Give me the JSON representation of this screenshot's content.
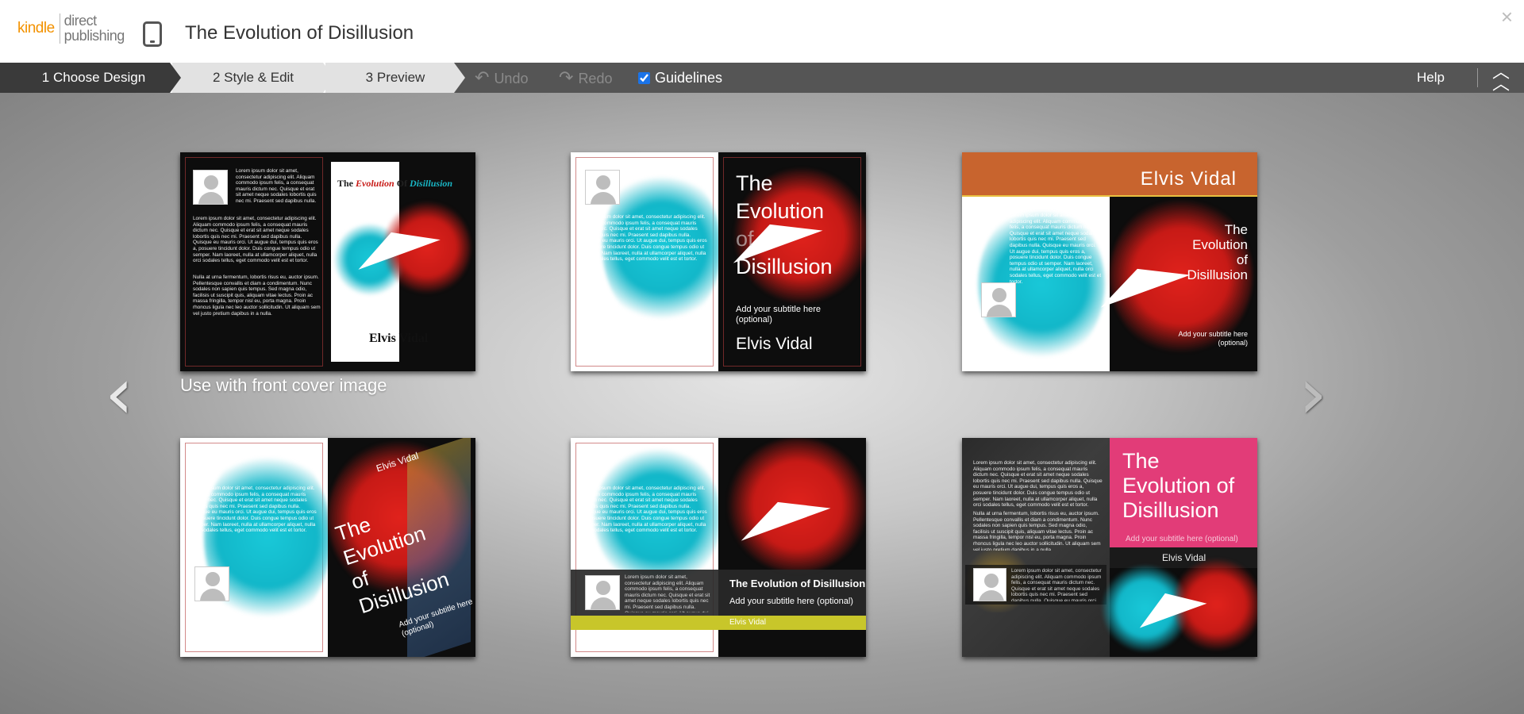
{
  "header": {
    "logo_kindle": "kindle",
    "logo_direct": "direct",
    "logo_publishing": "publishing",
    "book_title": "The Evolution of Disillusion",
    "close_label": "×"
  },
  "toolbar": {
    "steps": [
      {
        "label": "1 Choose Design"
      },
      {
        "label": "2 Style & Edit"
      },
      {
        "label": "3 Preview"
      }
    ],
    "undo_label": "Undo",
    "redo_label": "Redo",
    "guidelines_label": "Guidelines",
    "guidelines_checked": true,
    "help_label": "Help"
  },
  "gallery": {
    "caption": "Use with front cover image",
    "nav_left": "‹",
    "nav_right": "›",
    "lorem_short": "Lorem ipsum dolor sit amet, consectetur adipiscing elit. Aliquam commodo ipsum felis, a consequat mauris dictum nec. Quisque et erat sit amet neque sodales lobortis quis nec mi. Praesent sed dapibus nulla. Quisque eu mauris orci. Ut augue dui, tempus quis eros a, posuere tincidunt dolor. Duis congue tempus odio ut semper.",
    "lorem_long": "Lorem ipsum dolor sit amet, consectetur adipiscing elit. Aliquam commodo ipsum felis, a consequat mauris dictum nec. Quisque et erat sit amet neque sodales lobortis quis nec mi. Praesent sed dapibus nulla. Quisque eu mauris orci. Ut augue dui, tempus quis eros a, posuere tincidunt dolor. Duis congue tempus odio ut semper. Nam laoreet, nulla at ullamcorper aliquet, nulla orci sodales tellus, eget commodo velit est et tortor.",
    "lorem_para2": "Nulla at urna fermentum, lobortis risus eu, auctor ipsum. Pellentesque convallis et diam a condimentum. Nunc sodales non sapien quis tempus. Sed magna odio, facilisis ut suscipit quis, aliquam vitae lectus. Proin ac massa fringilla, tempor nisl eu, porta magna. Proin rhoncus ligula nec leo auctor sollicitudin. Ut aliquam sem vel justo pretium dapibus in a nulla.",
    "designs": [
      {
        "title_the": "The",
        "title_evolution": "Evolution",
        "title_of": "Of",
        "title_disillusion": "Disillusion",
        "author": "Elvis Vidal"
      },
      {
        "title_l1": "The",
        "title_l2": "Evolution",
        "title_l3": "of",
        "title_l4": "Disillusion",
        "subtitle": "Add your subtitle here (optional)",
        "author": "Elvis Vidal"
      },
      {
        "author": "Elvis Vidal",
        "title_l1": "The",
        "title_l2": "Evolution",
        "title_l3": "of",
        "title_l4": "Disillusion",
        "subtitle": "Add your subtitle here (optional)"
      },
      {
        "author": "Elvis Vidal",
        "title_l1": "The",
        "title_l2": "Evolution",
        "title_l3": "of",
        "title_l4": "Disillusion",
        "subtitle": "Add your subtitle here (optional)"
      },
      {
        "title": "The Evolution of Disillusion",
        "subtitle": "Add your subtitle here (optional)",
        "author": "Elvis Vidal"
      },
      {
        "title_l1": "The",
        "title_l2": "Evolution of",
        "title_l3": "Disillusion",
        "subtitle": "Add your subtitle here (optional)",
        "author": "Elvis Vidal"
      }
    ]
  },
  "colors": {
    "accent_red": "#c71a16",
    "accent_cyan": "#12b7c9",
    "orange_band": "#c8642e",
    "pink_band": "#e23c78",
    "lime_band": "#c8c62a"
  }
}
